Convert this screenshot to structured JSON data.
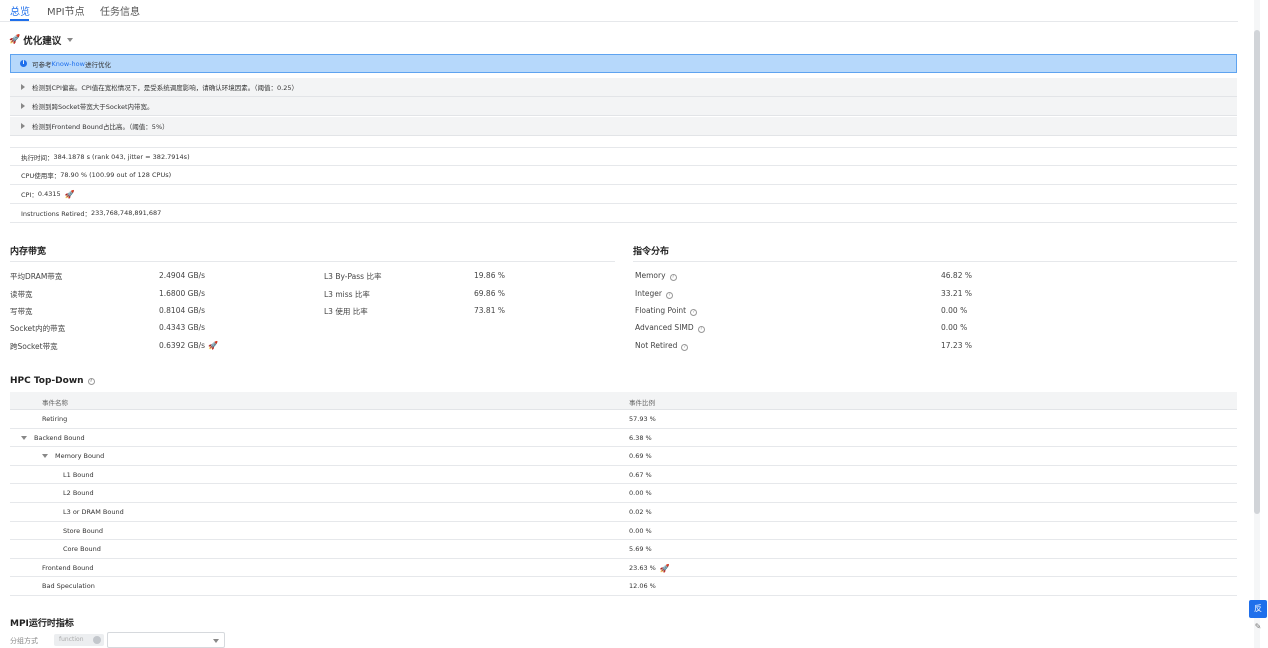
{
  "tabs": [
    "总览",
    "MPI节点",
    "任务信息"
  ],
  "optimization": {
    "title": "优化建议",
    "info": {
      "prefix": "可参考",
      "link": "Know-how",
      "suffix": "进行优化"
    },
    "suggestions": [
      "检测到CPI偏高。CPI值在宽松情况下，是受系统调度影响，请确认环境因素。（阈值：0.25）",
      "检测到跨Socket带宽大于Socket内带宽。",
      "检测到Frontend Bound占比高。（阈值：5%）"
    ]
  },
  "metrics": [
    {
      "label": "执行时间：",
      "value": "384.1878 s (rank 043, jitter = 382.7914s)",
      "flag": false
    },
    {
      "label": "CPU使用率：",
      "value": "78.90 % (100.99 out of 128 CPUs)",
      "flag": false
    },
    {
      "label": "CPI：",
      "value": "0.4315",
      "flag": true
    },
    {
      "label": "Instructions Retired：",
      "value": "233,768,748,891,687",
      "flag": false
    }
  ],
  "memory_bandwidth": {
    "title": "内存带宽",
    "left": [
      {
        "label": "平均DRAM带宽",
        "value": "2.4904 GB/s",
        "flag": false
      },
      {
        "label": "读带宽",
        "value": "1.6800 GB/s",
        "flag": false
      },
      {
        "label": "写带宽",
        "value": "0.8104 GB/s",
        "flag": false
      },
      {
        "label": "Socket内的带宽",
        "value": "0.4343 GB/s",
        "flag": false
      },
      {
        "label": "跨Socket带宽",
        "value": "0.6392 GB/s",
        "flag": true
      }
    ],
    "right": [
      {
        "label": "L3 By-Pass 比率",
        "value": "19.86 %"
      },
      {
        "label": "L3 miss 比率",
        "value": "69.86 %"
      },
      {
        "label": "L3 使用 比率",
        "value": "73.81 %"
      }
    ]
  },
  "instruction_distribution": {
    "title": "指令分布",
    "rows": [
      {
        "label": "Memory",
        "value": "46.82 %"
      },
      {
        "label": "Integer",
        "value": "33.21 %"
      },
      {
        "label": "Floating Point",
        "value": "0.00 %"
      },
      {
        "label": "Advanced SIMD",
        "value": "0.00 %"
      },
      {
        "label": "Not Retired",
        "value": "17.23 %"
      }
    ]
  },
  "hpc_topdown": {
    "title": "HPC Top-Down",
    "columns": [
      "事件名称",
      "事件比例"
    ],
    "rows": [
      {
        "name": "Retiring",
        "value": "57.93 %",
        "level": 0,
        "expandable": false,
        "flag": false
      },
      {
        "name": "Backend Bound",
        "value": "6.38 %",
        "level": 0,
        "expandable": true,
        "flag": false
      },
      {
        "name": "Memory Bound",
        "value": "0.69 %",
        "level": 1,
        "expandable": true,
        "flag": false
      },
      {
        "name": "L1 Bound",
        "value": "0.67 %",
        "level": 2,
        "expandable": false,
        "flag": false
      },
      {
        "name": "L2 Bound",
        "value": "0.00 %",
        "level": 2,
        "expandable": false,
        "flag": false
      },
      {
        "name": "L3 or DRAM Bound",
        "value": "0.02 %",
        "level": 2,
        "expandable": false,
        "flag": false
      },
      {
        "name": "Store Bound",
        "value": "0.00 %",
        "level": 2,
        "expandable": false,
        "flag": false
      },
      {
        "name": "Core Bound",
        "value": "5.69 %",
        "level": 2,
        "expandable": false,
        "flag": false
      },
      {
        "name": "Frontend Bound",
        "value": "23.63 %",
        "level": 0,
        "expandable": false,
        "flag": true
      },
      {
        "name": "Bad Speculation",
        "value": "12.06 %",
        "level": 0,
        "expandable": false,
        "flag": false
      }
    ]
  },
  "mpi": {
    "title": "MPI运行时指标",
    "group_label": "分组方式",
    "group_value": "function"
  },
  "float_button": "反",
  "icons": {
    "flag": "rocket-icon",
    "help": "question-circle-icon",
    "info": "info-circle-icon"
  },
  "colors": {
    "accent": "#1f6feb",
    "info_bg": "#b6d8fb"
  }
}
